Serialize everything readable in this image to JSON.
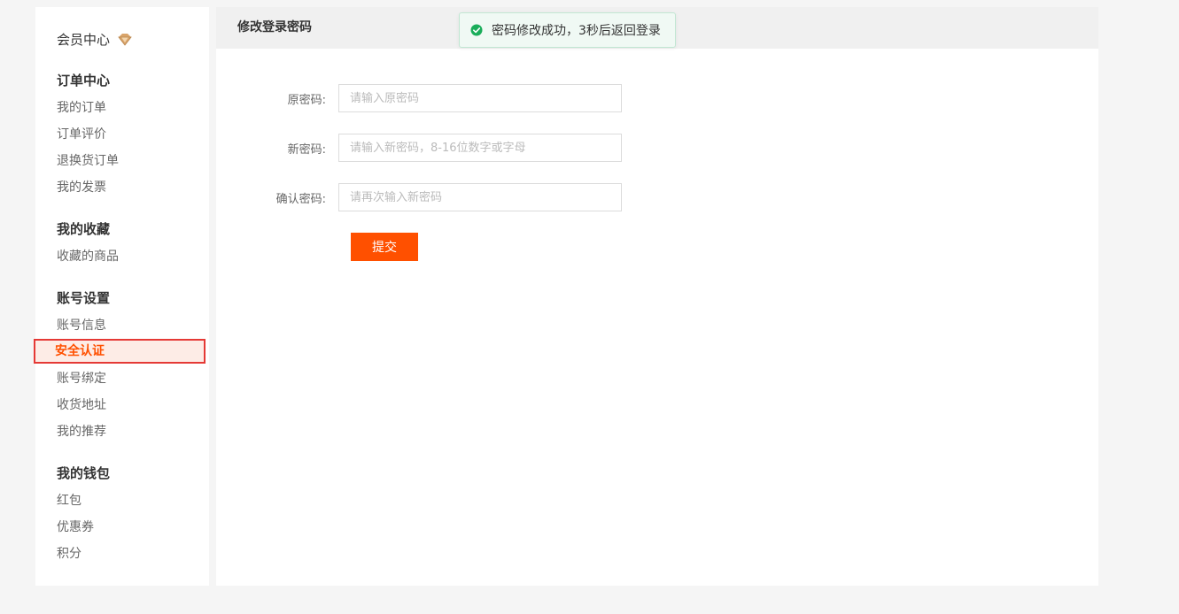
{
  "sidebar": {
    "member_center": "会员中心",
    "groups": [
      {
        "title": "订单中心",
        "items": [
          "我的订单",
          "订单评价",
          "退换货订单",
          "我的发票"
        ]
      },
      {
        "title": "我的收藏",
        "items": [
          "收藏的商品"
        ]
      },
      {
        "title": "账号设置",
        "items": [
          "账号信息",
          "安全认证",
          "账号绑定",
          "收货地址",
          "我的推荐"
        ]
      },
      {
        "title": "我的钱包",
        "items": [
          "红包",
          "优惠券",
          "积分"
        ]
      }
    ],
    "active_item": "安全认证"
  },
  "main": {
    "title": "修改登录密码",
    "toast": "密码修改成功，3秒后返回登录",
    "fields": [
      {
        "label": "原密码:",
        "placeholder": "请输入原密码"
      },
      {
        "label": "新密码:",
        "placeholder": "请输入新密码，8-16位数字或字母"
      },
      {
        "label": "确认密码:",
        "placeholder": "请再次输入新密码"
      }
    ],
    "submit_label": "提交"
  },
  "colors": {
    "accent": "#ff5000",
    "active_bg": "#fdece6",
    "toast_bg": "#f0f9f4",
    "success": "#1aad5a"
  }
}
